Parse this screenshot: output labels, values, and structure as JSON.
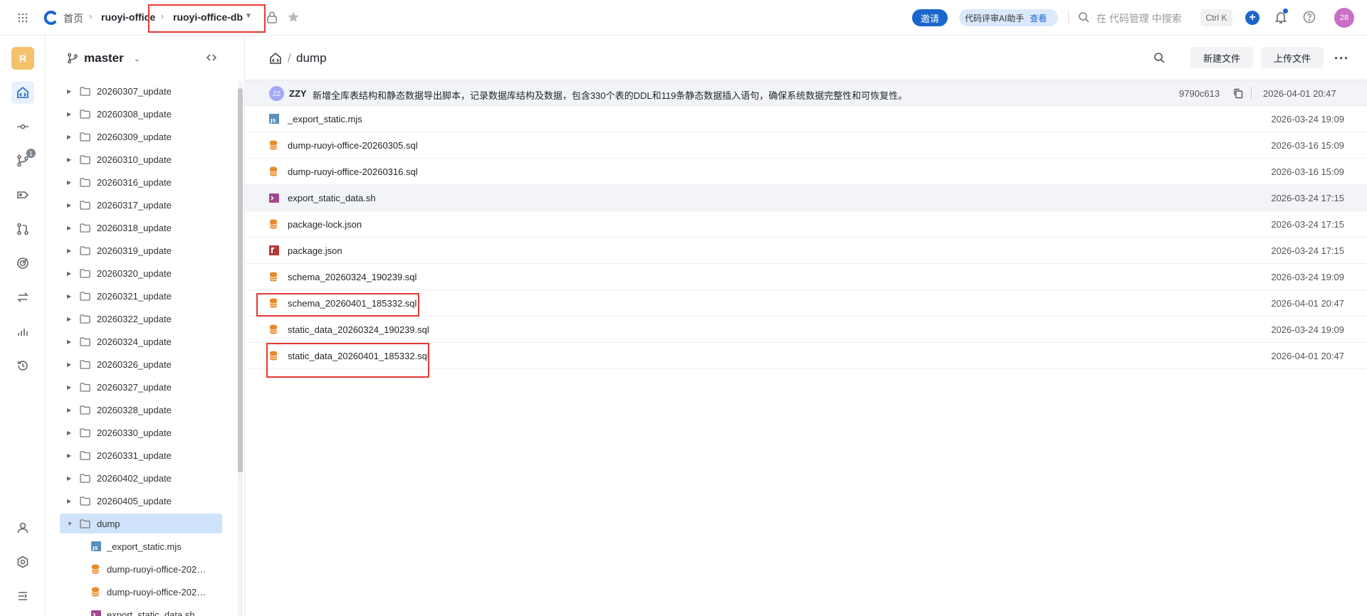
{
  "header": {
    "breadcrumb": {
      "home": "首页",
      "org": "ruoyi-office",
      "repo": "ruoyi-office-db"
    },
    "invite_label": "邀请",
    "ai_label": "代码评审AI助手",
    "ai_link": "查看",
    "search_placeholder": "在 代码管理 中搜索",
    "shortcut": "Ctrl K",
    "avatar_text": "28"
  },
  "rail": {
    "org_letter": "R",
    "branch_badge": "1"
  },
  "tree": {
    "branch": "master",
    "folders": [
      "20260307_update",
      "20260308_update",
      "20260309_update",
      "20260310_update",
      "20260316_update",
      "20260317_update",
      "20260318_update",
      "20260319_update",
      "20260320_update",
      "20260321_update",
      "20260322_update",
      "20260324_update",
      "20260326_update",
      "20260327_update",
      "20260328_update",
      "20260330_update",
      "20260331_update",
      "20260402_update",
      "20260405_update"
    ],
    "selected_folder": "dump",
    "files": [
      {
        "name": "_export_static.mjs",
        "type": "js"
      },
      {
        "name": "dump-ruoyi-office-202…",
        "type": "db"
      },
      {
        "name": "dump-ruoyi-office-202…",
        "type": "db"
      },
      {
        "name": "export_static_data.sh",
        "type": "sh"
      }
    ]
  },
  "main": {
    "path": "dump",
    "new_file_label": "新建文件",
    "upload_label": "上传文件",
    "commit": {
      "avatar": "ZZ",
      "author": "ZZY",
      "message": "新增全库表结构和静态数据导出脚本，记录数据库结构及数据，包含330个表的DDL和119条静态数据插入语句，确保系统数据完整性和可恢复性。",
      "hash": "9790c613",
      "date": "2026-04-01 20:47"
    },
    "files": [
      {
        "name": "_export_static.mjs",
        "date": "2026-03-24 19:09",
        "type": "js"
      },
      {
        "name": "dump-ruoyi-office-20260305.sql",
        "date": "2026-03-16 15:09",
        "type": "db"
      },
      {
        "name": "dump-ruoyi-office-20260316.sql",
        "date": "2026-03-16 15:09",
        "type": "db"
      },
      {
        "name": "export_static_data.sh",
        "date": "2026-03-24 17:15",
        "type": "sh"
      },
      {
        "name": "package-lock.json",
        "date": "2026-03-24 17:15",
        "type": "db"
      },
      {
        "name": "package.json",
        "date": "2026-03-24 17:15",
        "type": "npm"
      },
      {
        "name": "schema_20260324_190239.sql",
        "date": "2026-03-24 19:09",
        "type": "db"
      },
      {
        "name": "schema_20260401_185332.sql",
        "date": "2026-04-01 20:47",
        "type": "db"
      },
      {
        "name": "static_data_20260324_190239.sql",
        "date": "2026-03-24 19:09",
        "type": "db"
      },
      {
        "name": "static_data_20260401_185332.sql",
        "date": "2026-04-01 20:47",
        "type": "db"
      }
    ]
  },
  "colors": {
    "accent": "#1a66cc",
    "highlight": "#e53935",
    "selected": "#cfe4fb",
    "db_icon": "#e8892b"
  }
}
